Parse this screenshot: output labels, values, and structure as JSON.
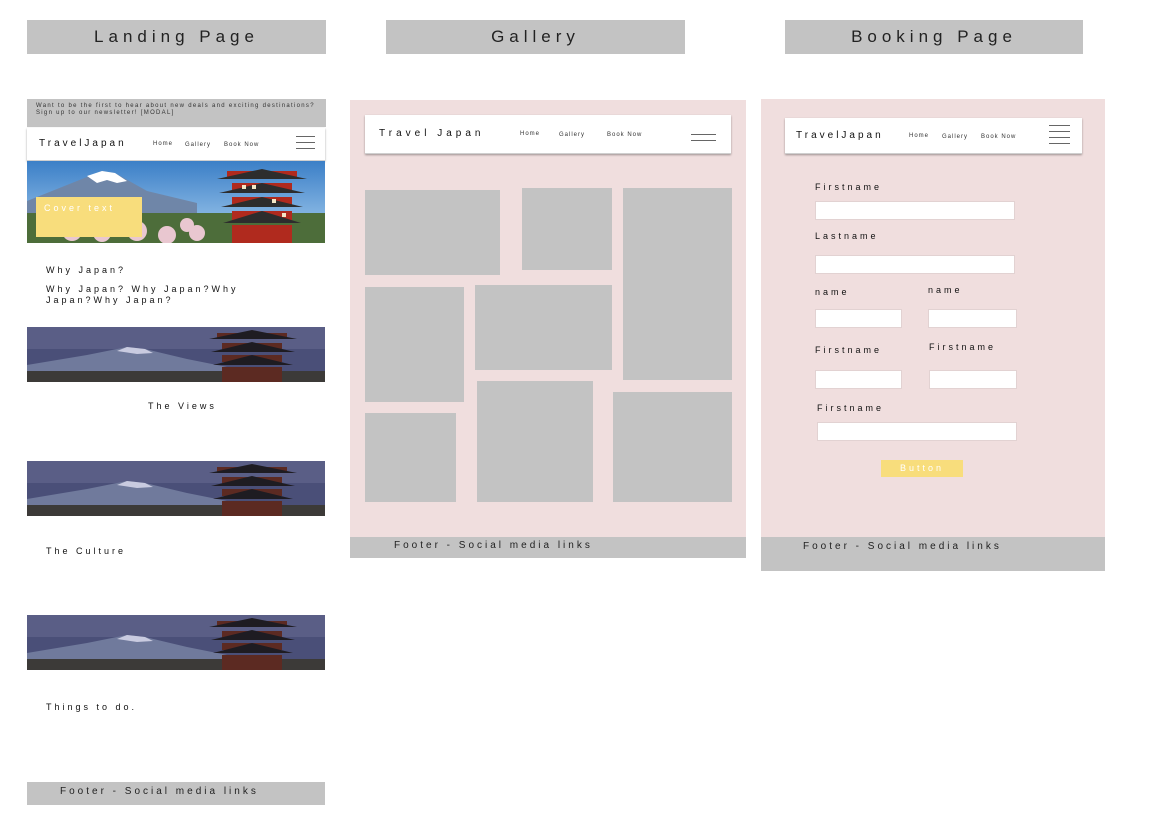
{
  "titles": {
    "landing": "Landing Page",
    "gallery": "Gallery",
    "booking": "Booking Page"
  },
  "landing": {
    "banner_text": "Want to be the first to hear about new deals and exciting destinations? Sign up to our newsletter! [MODAL]",
    "brand": "TravelJapan",
    "nav": [
      "Home",
      "Gallery",
      "Book Now"
    ],
    "hero_cover_text": "Cover text",
    "section1_heading": "Why Japan?",
    "section1_body": "Why Japan? Why Japan?Why Japan?Why Japan?",
    "section2_heading": "The Views",
    "section3_heading": "The Culture",
    "section4_heading": "Things to do.",
    "footer": "Footer - Social media links"
  },
  "gallery": {
    "brand": "Travel Japan",
    "nav": [
      "Home",
      "Gallery",
      "Book Now"
    ],
    "footer": "Footer - Social media links"
  },
  "booking": {
    "brand": "TravelJapan",
    "nav": [
      "Home",
      "Gallery",
      "Book Now"
    ],
    "labels": {
      "firstname": "Firstname",
      "lastname": "Lastname",
      "name_left": "name",
      "name_right": "name",
      "firstname_left": "Firstname",
      "firstname_right": "Firstname",
      "firstname_bottom": "Firstname"
    },
    "button": "Button",
    "footer": "Footer - Social media links"
  },
  "colors": {
    "placeholder_grey": "#c3c3c3",
    "wireframe_pink": "#f0dede",
    "accent_yellow": "#f8dd7c"
  }
}
